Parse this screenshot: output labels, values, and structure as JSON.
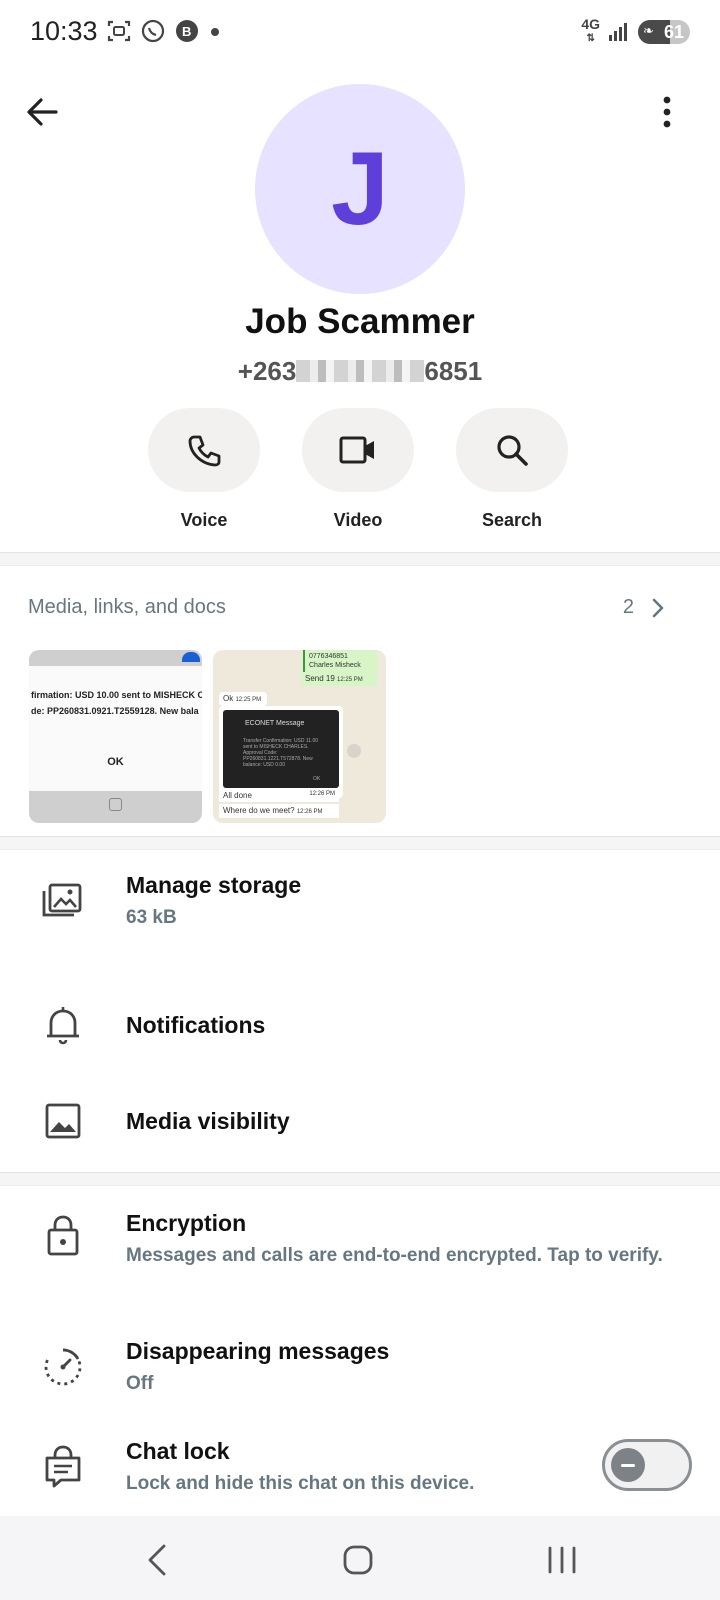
{
  "status_bar": {
    "time": "10:33",
    "network": "4G",
    "battery": "61",
    "battery_level": 0.61,
    "icons": [
      "screenshot-icon",
      "whatsapp-icon",
      "whatsapp-business-icon",
      "dot-icon",
      "signal-icon",
      "battery-icon"
    ]
  },
  "header": {
    "back_icon": "arrow-left-icon",
    "more_icon": "more-vertical-icon"
  },
  "contact": {
    "avatar_letter": "J",
    "avatar_bg": "#e6e2ff",
    "avatar_fg": "#5f3fd9",
    "name": "Job Scammer",
    "phone_prefix": "+263",
    "phone_suffix": "6851"
  },
  "actions": [
    {
      "label": "Voice",
      "icon": "phone-icon"
    },
    {
      "label": "Video",
      "icon": "video-icon"
    },
    {
      "label": "Search",
      "icon": "search-icon"
    }
  ],
  "media": {
    "header": "Media, links, and docs",
    "count": "2",
    "thumb1": {
      "line1": "firmation: USD 10.00 sent to MISHECK C",
      "line2": "de: PP260831.0921.T2559128. New bala",
      "ok": "OK"
    },
    "thumb2": {
      "green_line1": "0776346851",
      "green_line2": "Charles Misheck",
      "send": "Send 19",
      "send_time": "12:25 PM",
      "ok": "Ok",
      "ok_time": "12:25 PM",
      "screen_title": "ECONET Message",
      "screen_body": "Transfer Confirmation: USD 11.00 sent to MISHECK CHARLES. Approval Code: PP260831.1221.T572878. New balance: USD 0.00",
      "screen_ok": "OK",
      "done": "All done",
      "done_time": "12:26 PM",
      "where": "Where do we meet?",
      "where_time": "12:26 PM"
    }
  },
  "settings": [
    {
      "title": "Manage storage",
      "subtitle": "63 kB",
      "icon": "storage-icon"
    },
    {
      "title": "Notifications",
      "subtitle": "",
      "icon": "bell-icon"
    },
    {
      "title": "Media visibility",
      "subtitle": "",
      "icon": "image-icon"
    }
  ],
  "privacy": [
    {
      "title": "Encryption",
      "subtitle": "Messages and calls are end-to-end encrypted. Tap to verify.",
      "icon": "lock-icon"
    },
    {
      "title": "Disappearing messages",
      "subtitle": "Off",
      "icon": "timer-icon"
    },
    {
      "title": "Chat lock",
      "subtitle": "Lock and hide this chat on this device.",
      "icon": "chat-lock-icon",
      "toggle_on": false
    }
  ],
  "nav": {
    "back_icon": "nav-back-icon",
    "home_icon": "nav-home-icon",
    "recents_icon": "nav-recents-icon"
  }
}
